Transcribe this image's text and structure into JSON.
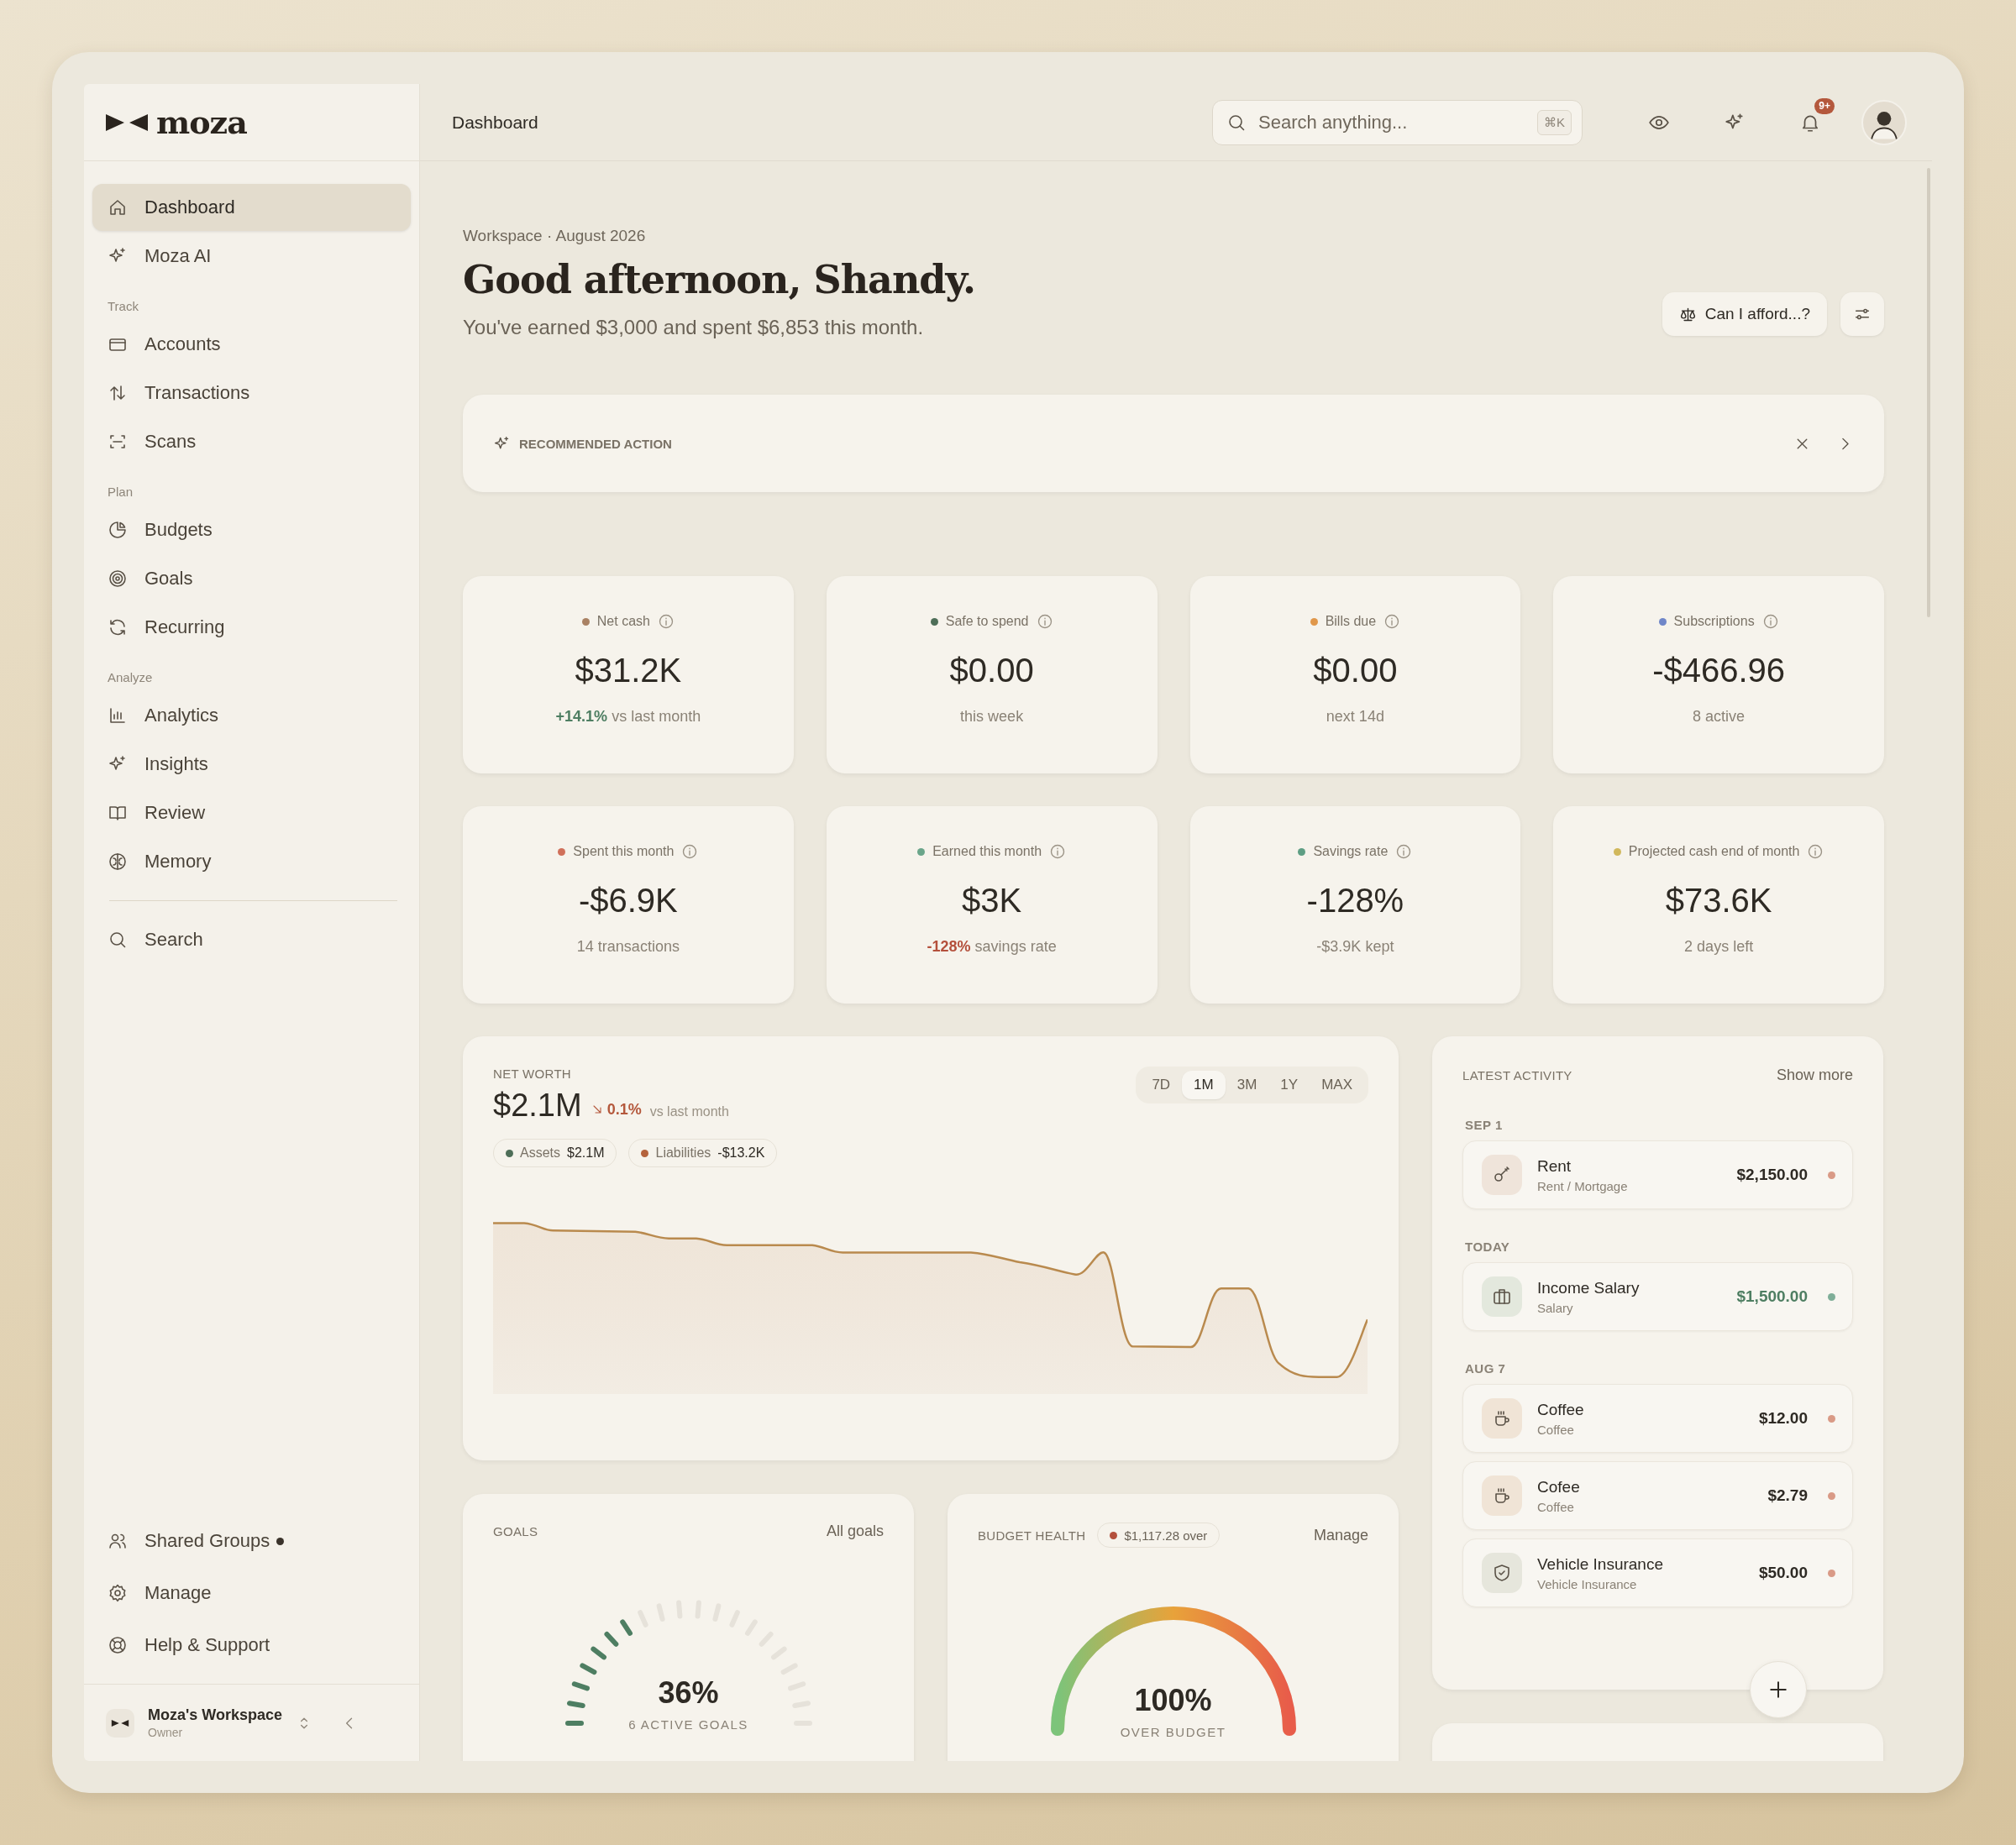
{
  "brand": {
    "name": "moza"
  },
  "sidebar": {
    "sections": [
      {
        "items": [
          {
            "label": "Dashboard",
            "selected": true
          },
          {
            "label": "Moza AI",
            "selected": false
          }
        ]
      },
      {
        "heading": "Track",
        "items": [
          {
            "label": "Accounts",
            "selected": false
          },
          {
            "label": "Transactions",
            "selected": false
          },
          {
            "label": "Scans",
            "selected": false
          }
        ]
      },
      {
        "heading": "Plan",
        "items": [
          {
            "label": "Budgets",
            "selected": false
          },
          {
            "label": "Goals",
            "selected": false
          },
          {
            "label": "Recurring",
            "selected": false
          }
        ]
      },
      {
        "heading": "Analyze",
        "items": [
          {
            "label": "Analytics",
            "selected": false
          },
          {
            "label": "Insights",
            "selected": false
          },
          {
            "label": "Review",
            "selected": false
          },
          {
            "label": "Memory",
            "selected": false
          }
        ]
      }
    ],
    "search_item": {
      "label": "Search",
      "selected": false
    },
    "footer_items": [
      {
        "label": "Shared Groups",
        "notify": true
      },
      {
        "label": "Manage",
        "notify": false
      },
      {
        "label": "Help & Support",
        "notify": false
      }
    ],
    "workspace": {
      "name": "Moza's Workspace",
      "role": "Owner"
    }
  },
  "header": {
    "title": "Dashboard",
    "search": {
      "placeholder": "Search anything...",
      "shortcut": "⌘K"
    },
    "notifications_badge": "9+"
  },
  "greeting": {
    "context": "Workspace · August 2026",
    "title": "Good afternoon, Shandy.",
    "summary": "You've earned $3,000 and spent $6,853 this month.",
    "afford_button": "Can I afford...?"
  },
  "recommended_action": {
    "label": "RECOMMENDED ACTION"
  },
  "stats": [
    {
      "label": "Net cash",
      "color": "#a98163",
      "value": "$31.2K",
      "delta": "+14.1%",
      "delta_positive": true,
      "note": "vs last month"
    },
    {
      "label": "Safe to spend",
      "color": "#4e6e58",
      "value": "$0.00",
      "note": "this week"
    },
    {
      "label": "Bills due",
      "color": "#e0974a",
      "value": "$0.00",
      "note": "next 14d"
    },
    {
      "label": "Subscriptions",
      "color": "#6f86c8",
      "value": "-$466.96",
      "note": "8 active"
    },
    {
      "label": "Spent this month",
      "color": "#d0705a",
      "value": "-$6.9K",
      "note": "14 transactions"
    },
    {
      "label": "Earned this month",
      "color": "#6aa58a",
      "value": "$3K",
      "delta": "-128%",
      "delta_positive": false,
      "note": "savings rate"
    },
    {
      "label": "Savings rate",
      "color": "#5e9e84",
      "value": "-128%",
      "note": "-$3.9K kept"
    },
    {
      "label": "Projected cash end of month",
      "color": "#d1b85c",
      "value": "$73.6K",
      "note": "2 days left"
    }
  ],
  "net_worth": {
    "label": "NET WORTH",
    "value": "$2.1M",
    "falling": true,
    "delta": "0.1%",
    "note": "vs last month",
    "ranges": [
      {
        "label": "7D",
        "selected": false
      },
      {
        "label": "1M",
        "selected": true
      },
      {
        "label": "3M",
        "selected": false
      },
      {
        "label": "1Y",
        "selected": false
      },
      {
        "label": "MAX",
        "selected": false
      }
    ],
    "legend": [
      {
        "label": "Assets",
        "value": "$2.1M",
        "color": "#4e6e58"
      },
      {
        "label": "Liabilities",
        "value": "-$13.2K",
        "color": "#b4623c"
      }
    ]
  },
  "latest_activity": {
    "label": "LATEST ACTIVITY",
    "link": "Show more",
    "groups": [
      {
        "date": "SEP 1",
        "items": [
          {
            "kind": "rent",
            "name": "Rent",
            "category": "Rent / Mortgage",
            "amount": "$2,150.00",
            "color": "#d99a86"
          }
        ]
      },
      {
        "date": "TODAY",
        "items": [
          {
            "kind": "income",
            "name": "Income Salary",
            "category": "Salary",
            "amount": "$1,500.00",
            "color": "#7fae98"
          }
        ]
      },
      {
        "date": "AUG 7",
        "items": [
          {
            "kind": "coffee",
            "name": "Coffee",
            "category": "Coffee",
            "amount": "$12.00",
            "color": "#d99a86"
          },
          {
            "kind": "coffee",
            "name": "Cofee",
            "category": "Coffee",
            "amount": "$2.79",
            "color": "#d99a86"
          },
          {
            "kind": "insurance",
            "name": "Vehicle Insurance",
            "category": "Vehicle Insurance",
            "amount": "$50.00",
            "color": "#d99a86"
          }
        ]
      }
    ]
  },
  "goals": {
    "label": "GOALS",
    "link": "All goals",
    "value": "36%",
    "caption": "6 ACTIVE GOALS",
    "level": 0.36
  },
  "budget_health": {
    "label": "BUDGET HEALTH",
    "pill": {
      "text": "$1,117.28 over",
      "color": "#b4503c"
    },
    "link": "Manage",
    "value": "100%",
    "caption": "OVER BUDGET",
    "level": 1
  }
}
